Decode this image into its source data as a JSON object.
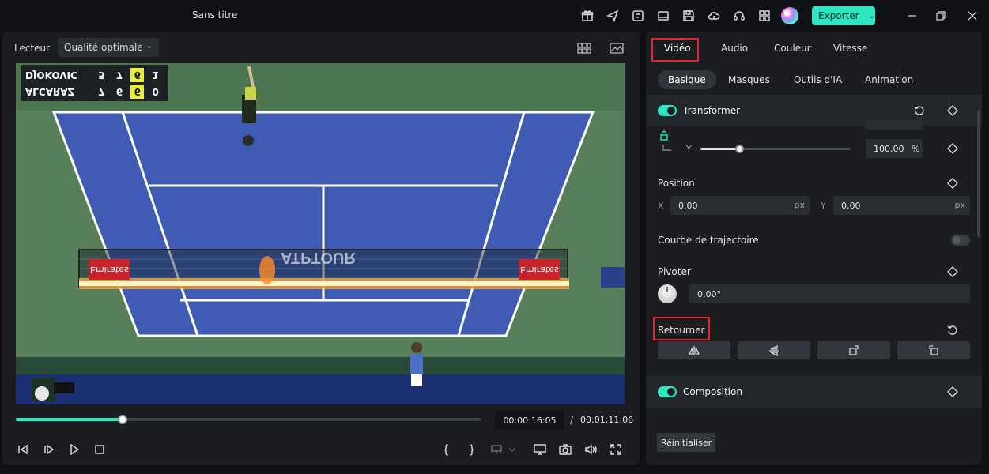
{
  "window": {
    "title": "Sans titre",
    "export_label": "Exporter"
  },
  "toolbar_icons": [
    "gift-icon",
    "send-icon",
    "template-icon",
    "layout-icon",
    "save-icon",
    "cloud-upload-icon",
    "headset-icon",
    "apps-grid-icon"
  ],
  "player": {
    "label": "Lecteur",
    "quality": "Qualité optimale",
    "current_time": "00:00:16:05",
    "separator": "/",
    "total_time": "00:01:11:06",
    "progress": 0.23
  },
  "scoreboard": {
    "rows": [
      {
        "name": "DJOKOVIC",
        "s1": "5",
        "s2": "7",
        "s3": "6",
        "s4": "1"
      },
      {
        "name": "ALCARAZ",
        "s1": "7",
        "s2": "6",
        "s3": "6",
        "s4": "0"
      }
    ]
  },
  "video_text": {
    "court_banner": "ATPTOUR",
    "sponsor": "Emirates"
  },
  "controls": {
    "mark_in": "{",
    "mark_out": "}"
  },
  "props": {
    "tabs": [
      "Vidéo",
      "Audio",
      "Couleur",
      "Vitesse"
    ],
    "subtabs": [
      "Basique",
      "Masques",
      "Outils d'IA",
      "Animation"
    ],
    "transform": {
      "title": "Transformer",
      "scale_y_axis": "Y",
      "scale_y_value": "100,00",
      "scale_y_unit": "%",
      "scale_y_fraction": 0.26
    },
    "position": {
      "title": "Position",
      "x_axis": "X",
      "x_value": "0,00",
      "x_unit": "px",
      "y_axis": "Y",
      "y_value": "0,00",
      "y_unit": "px"
    },
    "trajectory": {
      "title": "Courbe de trajectoire"
    },
    "rotate": {
      "title": "Pivoter",
      "value": "0,00°"
    },
    "flip": {
      "title": "Retourner"
    },
    "composition": {
      "title": "Composition"
    },
    "reset_label": "Réinitialiser"
  },
  "colors": {
    "accent": "#2ee6c2",
    "highlight": "#e3262f",
    "court": "#3f5bb3",
    "grass": "#4f7a56"
  }
}
